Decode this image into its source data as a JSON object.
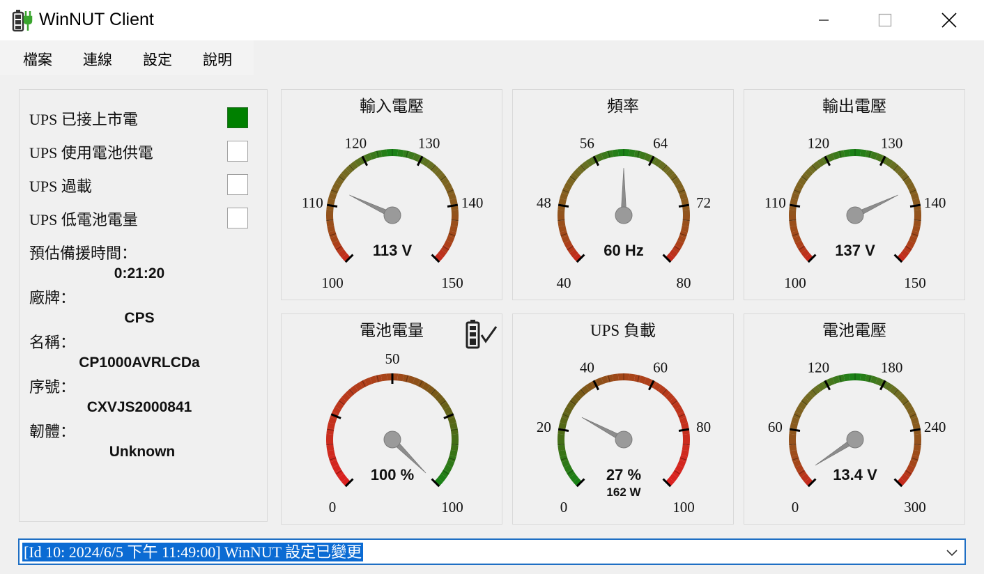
{
  "window": {
    "title": "WinNUT Client",
    "minimize_glyph": "—",
    "maximize_glyph": "☐",
    "close_glyph": "✕"
  },
  "menu": {
    "items": [
      "檔案",
      "連線",
      "設定",
      "說明"
    ]
  },
  "status": {
    "items": [
      {
        "label": "UPS 已接上市電",
        "active": true
      },
      {
        "label": "UPS 使用電池供電",
        "active": false
      },
      {
        "label": "UPS 過載",
        "active": false
      },
      {
        "label": "UPS 低電池電量",
        "active": false
      }
    ],
    "active_color": "#008000"
  },
  "info": {
    "runtime_label": "預估備援時間：",
    "runtime_value": "0:21:20",
    "brand_label": "廠牌：",
    "brand_value": "CPS",
    "name_label": "名稱：",
    "name_value": "CP1000AVRLCDa",
    "serial_label": "序號：",
    "serial_value": "CXVJS2000841",
    "firmware_label": "韌體：",
    "firmware_value": "Unknown"
  },
  "gauges": [
    {
      "id": "input-voltage",
      "title": "輸入電壓",
      "min": 100,
      "max": 150,
      "value": 113,
      "readout": "113 V",
      "sub": "",
      "tick_labels": [
        "100",
        "110",
        "120",
        "130",
        "140",
        "150"
      ],
      "palette": "redgreenred"
    },
    {
      "id": "frequency",
      "title": "頻率",
      "min": 40,
      "max": 80,
      "value": 60,
      "readout": "60 Hz",
      "sub": "",
      "tick_labels": [
        "40",
        "48",
        "56",
        "64",
        "72",
        "80"
      ],
      "palette": "redgreenred"
    },
    {
      "id": "output-voltage",
      "title": "輸出電壓",
      "min": 100,
      "max": 150,
      "value": 137,
      "readout": "137 V",
      "sub": "",
      "tick_labels": [
        "100",
        "110",
        "120",
        "130",
        "140",
        "150"
      ],
      "palette": "redgreenred"
    },
    {
      "id": "battery-charge",
      "title": "電池電量",
      "min": 0,
      "max": 100,
      "value": 100,
      "readout": "100 %",
      "sub": "",
      "tick_labels": [
        "0",
        "",
        "50",
        "",
        "100"
      ],
      "palette": "redtogreen",
      "battery_icon": "battery-check-icon"
    },
    {
      "id": "ups-load",
      "title": "UPS 負載",
      "min": 0,
      "max": 100,
      "value": 27,
      "readout": "27 %",
      "sub": "162 W",
      "tick_labels": [
        "0",
        "20",
        "40",
        "60",
        "80",
        "100"
      ],
      "palette": "greentored"
    },
    {
      "id": "battery-voltage",
      "title": "電池電壓",
      "min": 0,
      "max": 300,
      "value": 13.4,
      "readout": "13.4 V",
      "sub": "",
      "tick_labels": [
        "0",
        "60",
        "120",
        "180",
        "240",
        "300"
      ],
      "palette": "redgreenred"
    }
  ],
  "log": {
    "text": "[Id 10: 2024/6/5 下午 11:49:00] WinNUT 設定已變更"
  }
}
